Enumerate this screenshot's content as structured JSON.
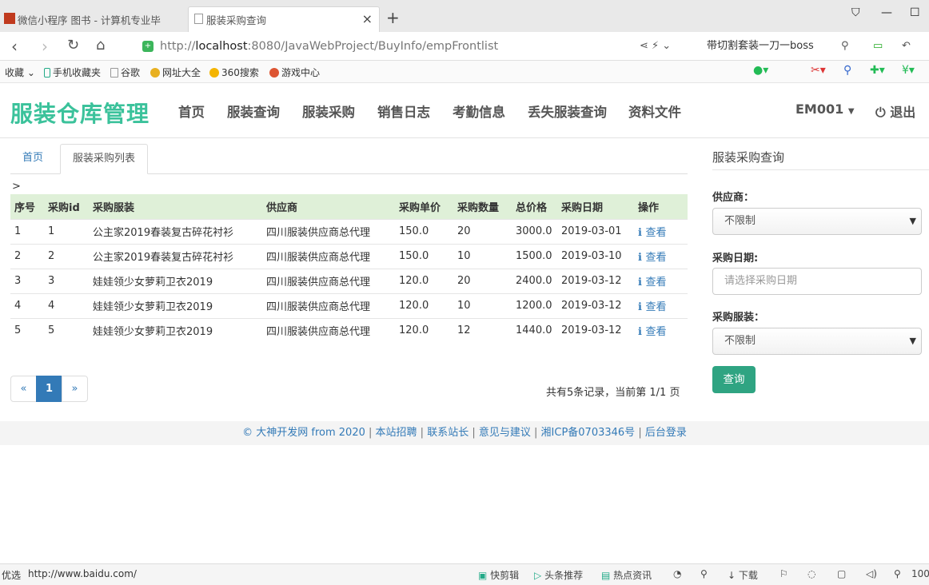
{
  "browser": {
    "tabs": [
      {
        "title": "微信小程序 图书 - 计算机专业毕"
      },
      {
        "title": "服装采购查询"
      }
    ],
    "url_prefix": "http://",
    "url_host": "localhost",
    "url_rest": ":8080/JavaWebProject/BuyInfo/empFrontlist",
    "search_text": "带切割套装一刀一boss",
    "bookmarks": [
      "收藏",
      "手机收藏夹",
      "谷歌",
      "网址大全",
      "360搜索",
      "游戏中心"
    ],
    "status_left": "优选",
    "status_url": "http://www.baidu.com/",
    "status_items": [
      "快剪辑",
      "头条推荐",
      "热点资讯",
      "下载",
      "100"
    ]
  },
  "nav": {
    "brand": "服装仓库管理",
    "items": [
      "首页",
      "服装查询",
      "服装采购",
      "销售日志",
      "考勤信息",
      "丢失服装查询",
      "资料文件"
    ],
    "user": "EM001",
    "logout": "退出"
  },
  "page_tabs": {
    "home": "首页",
    "active": "服装采购列表"
  },
  "breadcrumb": ">",
  "table": {
    "headers": [
      "序号",
      "采购id",
      "采购服装",
      "供应商",
      "采购单价",
      "采购数量",
      "总价格",
      "采购日期",
      "操作"
    ],
    "rows": [
      [
        "1",
        "1",
        "公主家2019春装复古碎花衬衫",
        "四川服装供应商总代理",
        "150.0",
        "20",
        "3000.0",
        "2019-03-01",
        "查看"
      ],
      [
        "2",
        "2",
        "公主家2019春装复古碎花衬衫",
        "四川服装供应商总代理",
        "150.0",
        "10",
        "1500.0",
        "2019-03-10",
        "查看"
      ],
      [
        "3",
        "3",
        "娃娃领少女萝莉卫衣2019",
        "四川服装供应商总代理",
        "120.0",
        "20",
        "2400.0",
        "2019-03-12",
        "查看"
      ],
      [
        "4",
        "4",
        "娃娃领少女萝莉卫衣2019",
        "四川服装供应商总代理",
        "120.0",
        "10",
        "1200.0",
        "2019-03-12",
        "查看"
      ],
      [
        "5",
        "5",
        "娃娃领少女萝莉卫衣2019",
        "四川服装供应商总代理",
        "120.0",
        "12",
        "1440.0",
        "2019-03-12",
        "查看"
      ]
    ]
  },
  "pager": {
    "prev": "«",
    "current": "1",
    "next": "»",
    "info": "共有5条记录，当前第 1/1 页"
  },
  "sidebar": {
    "title": "服装采购查询",
    "supplier_label": "供应商：",
    "supplier_value": "不限制",
    "date_label": "采购日期:",
    "date_placeholder": "请选择采购日期",
    "clothes_label": "采购服装：",
    "clothes_value": "不限制",
    "query_button": "查询"
  },
  "footer": {
    "links": [
      "© 大神开发网 from 2020",
      "本站招聘",
      "联系站长",
      "意见与建议",
      "湘ICP备0703346号",
      "后台登录"
    ]
  }
}
